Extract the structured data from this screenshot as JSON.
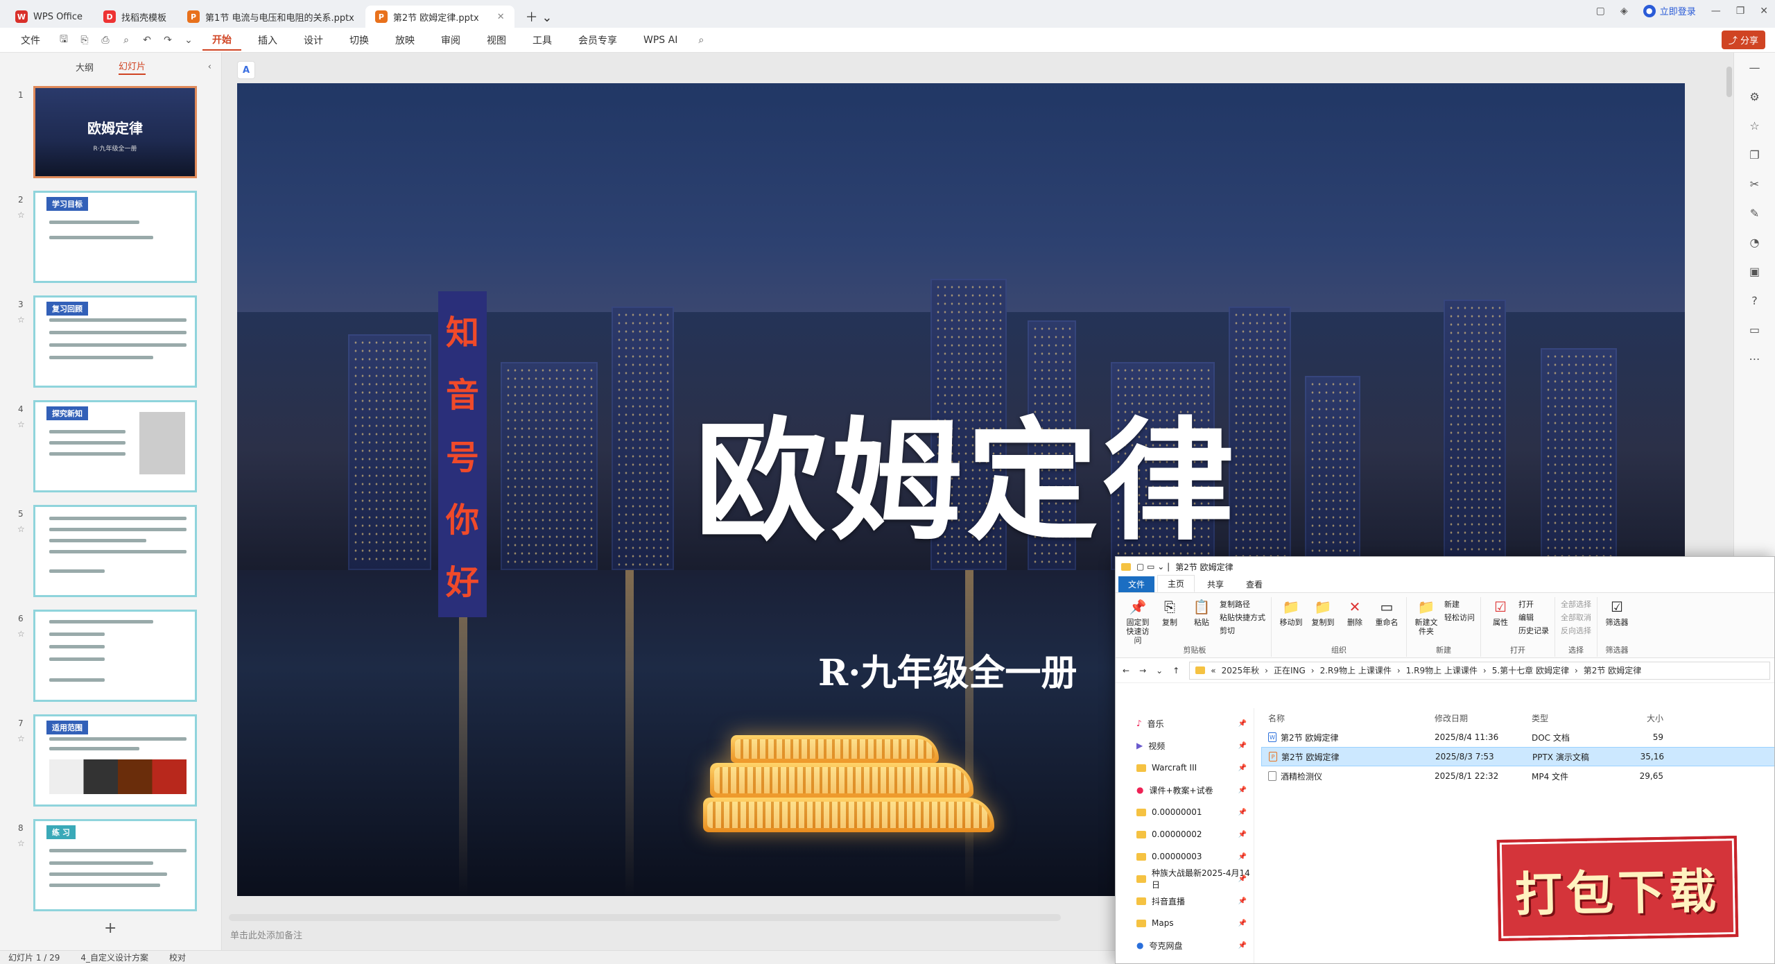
{
  "tabs": [
    {
      "label": "WPS Office",
      "icon": "W",
      "color": "#d9302a"
    },
    {
      "label": "找稻壳模板",
      "icon": "D",
      "color": "#e33"
    },
    {
      "label": "第1节 电流与电压和电阻的关系.pptx",
      "icon": "P",
      "color": "#e8711c"
    },
    {
      "label": "第2节 欧姆定律.pptx",
      "icon": "P",
      "color": "#e8711c"
    }
  ],
  "login": "立即登录",
  "menu": [
    "文件",
    "开始",
    "插入",
    "设计",
    "切换",
    "放映",
    "审阅",
    "视图",
    "工具",
    "会员专享",
    "WPS AI"
  ],
  "share_label": "分享",
  "panel": {
    "outline_tab": "大纲",
    "slides_tab": "幻灯片"
  },
  "slides": [
    {
      "num": "1",
      "title": "欧姆定律",
      "subtitle": "R·九年级全一册"
    },
    {
      "num": "2",
      "header": "学习目标"
    },
    {
      "num": "3",
      "header": "复习回顾"
    },
    {
      "num": "4",
      "header": "探究新知"
    },
    {
      "num": "5",
      "header": ""
    },
    {
      "num": "6",
      "header": ""
    },
    {
      "num": "7",
      "header": "适用范围"
    },
    {
      "num": "8",
      "header": "练 习"
    }
  ],
  "stage": {
    "title": "欧姆定律",
    "subtitle": "R·九年级全一册",
    "sign_chars": [
      "知",
      "音",
      "号",
      "你",
      "好"
    ]
  },
  "notes_placeholder": "单击此处添加备注",
  "status": {
    "slide_counter": "幻灯片 1 / 29",
    "theme": "4_自定义设计方案",
    "proof": "校对"
  },
  "explorer": {
    "title": "第2节 欧姆定律",
    "tabs": [
      "文件",
      "主页",
      "共享",
      "查看"
    ],
    "ribbon": {
      "clipboard": {
        "pin": "固定到快速访问",
        "copy": "复制",
        "paste": "粘贴",
        "copy_path": "复制路径",
        "paste_shortcut": "粘贴快捷方式",
        "cut": "剪切",
        "label": "剪贴板"
      },
      "organize": {
        "move_to": "移动到",
        "copy_to": "复制到",
        "delete": "删除",
        "rename": "重命名",
        "label": "组织"
      },
      "new": {
        "new_folder": "新建文件夹",
        "new_item": "新建",
        "easy_access": "轻松访问",
        "label": "新建"
      },
      "open": {
        "properties": "属性",
        "open": "打开",
        "edit": "编辑",
        "history": "历史记录",
        "label": "打开"
      },
      "select": {
        "select_all": "全部选择",
        "select_none": "全部取消",
        "invert": "反向选择",
        "label": "选择"
      },
      "filter": {
        "filter": "筛选器",
        "label": "筛选器"
      }
    },
    "path": [
      "«",
      "2025年秋",
      "正在ING",
      "2.R9物上 上课课件",
      "1.R9物上 上课课件",
      "5.第十七章 欧姆定律",
      "第2节 欧姆定律"
    ],
    "nav": [
      "音乐",
      "视频",
      "Warcraft III",
      "课件+教案+试卷",
      "0.00000001",
      "0.00000002",
      "0.00000003",
      "种族大战最新2025-4月14日",
      "抖音直播",
      "Maps",
      "夸克网盘"
    ],
    "columns": [
      "名称",
      "修改日期",
      "类型",
      "大小"
    ],
    "files": [
      {
        "name": "第2节 欧姆定律",
        "date": "2025/8/4 11:36",
        "type": "DOC 文档",
        "size": "59"
      },
      {
        "name": "第2节 欧姆定律",
        "date": "2025/8/3 7:53",
        "type": "PPTX 演示文稿",
        "size": "35,16"
      },
      {
        "name": "酒精检测仪",
        "date": "2025/8/1 22:32",
        "type": "MP4 文件",
        "size": "29,65"
      }
    ]
  },
  "stamp": "打包下载"
}
